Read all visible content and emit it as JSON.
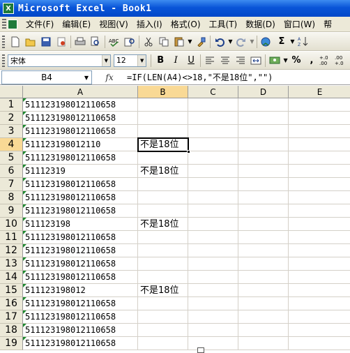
{
  "window": {
    "title": "Microsoft Excel - Book1",
    "app_icon": "X"
  },
  "menu": [
    "文件(F)",
    "编辑(E)",
    "视图(V)",
    "插入(I)",
    "格式(O)",
    "工具(T)",
    "数据(D)",
    "窗口(W)",
    "帮"
  ],
  "toolbar_standard": {
    "icons": [
      "new-icon",
      "open-icon",
      "save-icon",
      "permission-icon",
      "print-icon",
      "print-preview-icon",
      "spelling-icon",
      "research-icon",
      "cut-icon",
      "copy-icon",
      "paste-icon",
      "format-painter-icon",
      "undo-icon",
      "redo-icon",
      "hyperlink-icon",
      "autosum-icon",
      "sort-ascending-icon"
    ],
    "autosum_glyph": "Σ"
  },
  "toolbar_formatting": {
    "font_name": "宋体",
    "font_size": "12",
    "bold": "B",
    "italic": "I",
    "underline": "U",
    "percent": "%",
    "comma": ",",
    "increase_decimal": "+.0 .00",
    "decrease_decimal": ".00 +.0"
  },
  "formula_bar": {
    "name_box": "B4",
    "fx_label": "fx",
    "formula": "=IF(LEN(A4)<>18,\"不是18位\",\"\")"
  },
  "sheet": {
    "columns": [
      "A",
      "B",
      "C",
      "D",
      "E"
    ],
    "active_column": "B",
    "active_row": 4,
    "rows": [
      {
        "n": "1",
        "a": "511123198012110658",
        "b": ""
      },
      {
        "n": "2",
        "a": "511123198012110658",
        "b": ""
      },
      {
        "n": "3",
        "a": "511123198012110658",
        "b": ""
      },
      {
        "n": "4",
        "a": "511123198012110",
        "b": "不是18位"
      },
      {
        "n": "5",
        "a": "511123198012110658",
        "b": ""
      },
      {
        "n": "6",
        "a": "51112319",
        "b": "不是18位"
      },
      {
        "n": "7",
        "a": "511123198012110658",
        "b": ""
      },
      {
        "n": "8",
        "a": "511123198012110658",
        "b": ""
      },
      {
        "n": "9",
        "a": "511123198012110658",
        "b": ""
      },
      {
        "n": "10",
        "a": "511123198",
        "b": "不是18位"
      },
      {
        "n": "11",
        "a": "511123198012110658",
        "b": ""
      },
      {
        "n": "12",
        "a": "511123198012110658",
        "b": ""
      },
      {
        "n": "13",
        "a": "511123198012110658",
        "b": ""
      },
      {
        "n": "14",
        "a": "511123198012110658",
        "b": ""
      },
      {
        "n": "15",
        "a": "511123198012",
        "b": "不是18位"
      },
      {
        "n": "16",
        "a": "511123198012110658",
        "b": ""
      },
      {
        "n": "17",
        "a": "511123198012110658",
        "b": ""
      },
      {
        "n": "18",
        "a": "511123198012110658",
        "b": ""
      },
      {
        "n": "19",
        "a": "511123198012110658",
        "b": ""
      }
    ]
  },
  "colors": {
    "title_bar": "#0a55d8",
    "active_header": "#f9d995",
    "text_indicator": "#1e8a2e"
  }
}
